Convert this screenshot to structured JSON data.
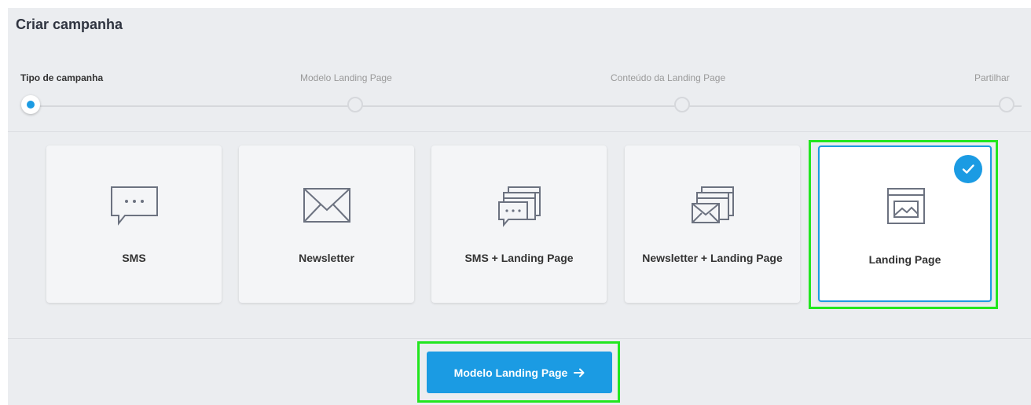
{
  "title": "Criar campanha",
  "steps": [
    {
      "label": "Tipo de campanha",
      "active": true
    },
    {
      "label": "Modelo Landing Page",
      "active": false
    },
    {
      "label": "Conteúdo da Landing Page",
      "active": false
    },
    {
      "label": "Partilhar",
      "active": false
    }
  ],
  "campaign_types": [
    {
      "label": "SMS",
      "icon": "sms-bubble-icon",
      "selected": false
    },
    {
      "label": "Newsletter",
      "icon": "envelope-icon",
      "selected": false
    },
    {
      "label": "SMS + Landing Page",
      "icon": "sms-landing-page-icon",
      "selected": false
    },
    {
      "label": "Newsletter + Landing Page",
      "icon": "newsletter-landing-page-icon",
      "selected": false
    },
    {
      "label": "Landing Page",
      "icon": "landing-page-icon",
      "selected": true
    }
  ],
  "next_button": {
    "label": "Modelo Landing Page",
    "icon": "arrow-right-icon"
  },
  "colors": {
    "accent": "#1b9be3",
    "highlight": "#22e61f",
    "background": "#ebedf0"
  }
}
